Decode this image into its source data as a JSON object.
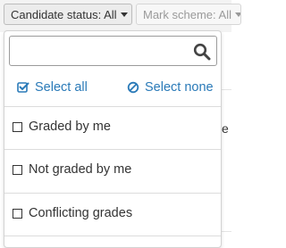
{
  "toolbar": {
    "candidate_status_label": "Candidate status: All",
    "mark_scheme_label": "Mark scheme: All"
  },
  "dropdown": {
    "search": {
      "value": "",
      "placeholder": ""
    },
    "select_all_label": "Select all",
    "select_none_label": "Select none",
    "options": [
      {
        "label": "Graded by me",
        "checked": false
      },
      {
        "label": "Not graded by me",
        "checked": false
      },
      {
        "label": "Conflicting grades",
        "checked": false
      }
    ]
  },
  "background": {
    "peek_letter": "e"
  },
  "colors": {
    "link": "#2a7ab8",
    "text": "#333333",
    "muted": "#9a9a9a",
    "border": "#d3d3d3"
  },
  "icons": {
    "search": "search-icon",
    "select_all": "check-square-icon",
    "select_none": "ban-icon",
    "caret": "caret-down-icon"
  }
}
